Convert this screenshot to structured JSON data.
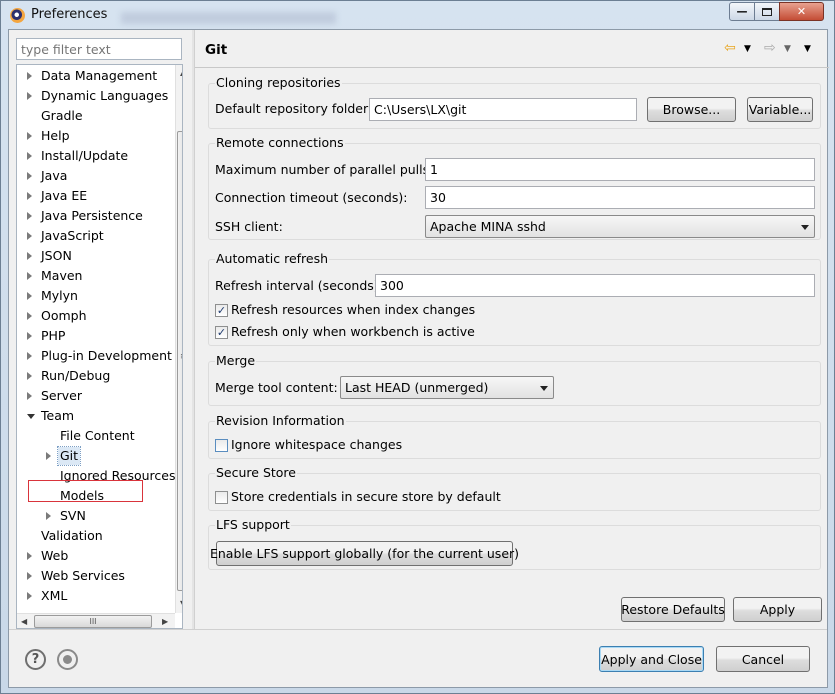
{
  "window": {
    "title": "Preferences"
  },
  "filter": {
    "placeholder": "type filter text"
  },
  "tree": {
    "items": [
      {
        "label": "Data Management",
        "level": 0,
        "expander": "collapsed"
      },
      {
        "label": "Dynamic Languages",
        "level": 0,
        "expander": "collapsed"
      },
      {
        "label": "Gradle",
        "level": 0,
        "expander": "none"
      },
      {
        "label": "Help",
        "level": 0,
        "expander": "collapsed"
      },
      {
        "label": "Install/Update",
        "level": 0,
        "expander": "collapsed"
      },
      {
        "label": "Java",
        "level": 0,
        "expander": "collapsed"
      },
      {
        "label": "Java EE",
        "level": 0,
        "expander": "collapsed"
      },
      {
        "label": "Java Persistence",
        "level": 0,
        "expander": "collapsed"
      },
      {
        "label": "JavaScript",
        "level": 0,
        "expander": "collapsed"
      },
      {
        "label": "JSON",
        "level": 0,
        "expander": "collapsed"
      },
      {
        "label": "Maven",
        "level": 0,
        "expander": "collapsed"
      },
      {
        "label": "Mylyn",
        "level": 0,
        "expander": "collapsed"
      },
      {
        "label": "Oomph",
        "level": 0,
        "expander": "collapsed"
      },
      {
        "label": "PHP",
        "level": 0,
        "expander": "collapsed"
      },
      {
        "label": "Plug-in Development",
        "level": 0,
        "expander": "collapsed"
      },
      {
        "label": "Run/Debug",
        "level": 0,
        "expander": "collapsed"
      },
      {
        "label": "Server",
        "level": 0,
        "expander": "collapsed"
      },
      {
        "label": "Team",
        "level": 0,
        "expander": "expanded"
      },
      {
        "label": "File Content",
        "level": 1,
        "expander": "none"
      },
      {
        "label": "Git",
        "level": 1,
        "expander": "collapsed",
        "selected": true
      },
      {
        "label": "Ignored Resources",
        "level": 1,
        "expander": "none"
      },
      {
        "label": "Models",
        "level": 1,
        "expander": "none"
      },
      {
        "label": "SVN",
        "level": 1,
        "expander": "collapsed"
      },
      {
        "label": "Validation",
        "level": 0,
        "expander": "none"
      },
      {
        "label": "Web",
        "level": 0,
        "expander": "collapsed"
      },
      {
        "label": "Web Services",
        "level": 0,
        "expander": "collapsed"
      },
      {
        "label": "XML",
        "level": 0,
        "expander": "collapsed"
      }
    ]
  },
  "page": {
    "title": "Git"
  },
  "cloning": {
    "title": "Cloning repositories",
    "folder_label": "Default repository folder:",
    "folder_value": "C:\\Users\\LX\\git",
    "browse": "Browse...",
    "variables": "Variable..."
  },
  "remote": {
    "title": "Remote connections",
    "pulls_label": "Maximum number of parallel pulls:",
    "pulls_value": "1",
    "timeout_label": "Connection timeout (seconds):",
    "timeout_value": "30",
    "ssh_label": "SSH client:",
    "ssh_value": "Apache MINA sshd"
  },
  "refresh": {
    "title": "Automatic refresh",
    "interval_label": "Refresh interval (seconds):",
    "interval_value": "300",
    "on_index_change": "Refresh resources when index changes",
    "on_active": "Refresh only when workbench is active",
    "on_index_change_checked": true,
    "on_active_checked": true
  },
  "merge": {
    "title": "Merge",
    "tool_label": "Merge tool content:",
    "tool_value": "Last HEAD (unmerged)"
  },
  "revision": {
    "title": "Revision Information",
    "ignore_ws": "Ignore whitespace changes",
    "ignore_ws_checked": false
  },
  "secure": {
    "title": "Secure Store",
    "store_label": "Store credentials in secure store by default",
    "store_checked": false
  },
  "lfs": {
    "title": "LFS support",
    "enable_button": "Enable LFS support globally (for the current user)"
  },
  "buttons": {
    "restore": "Restore Defaults",
    "apply": "Apply",
    "apply_close": "Apply and Close",
    "cancel": "Cancel"
  },
  "scrollbar": {
    "grip": "III"
  }
}
